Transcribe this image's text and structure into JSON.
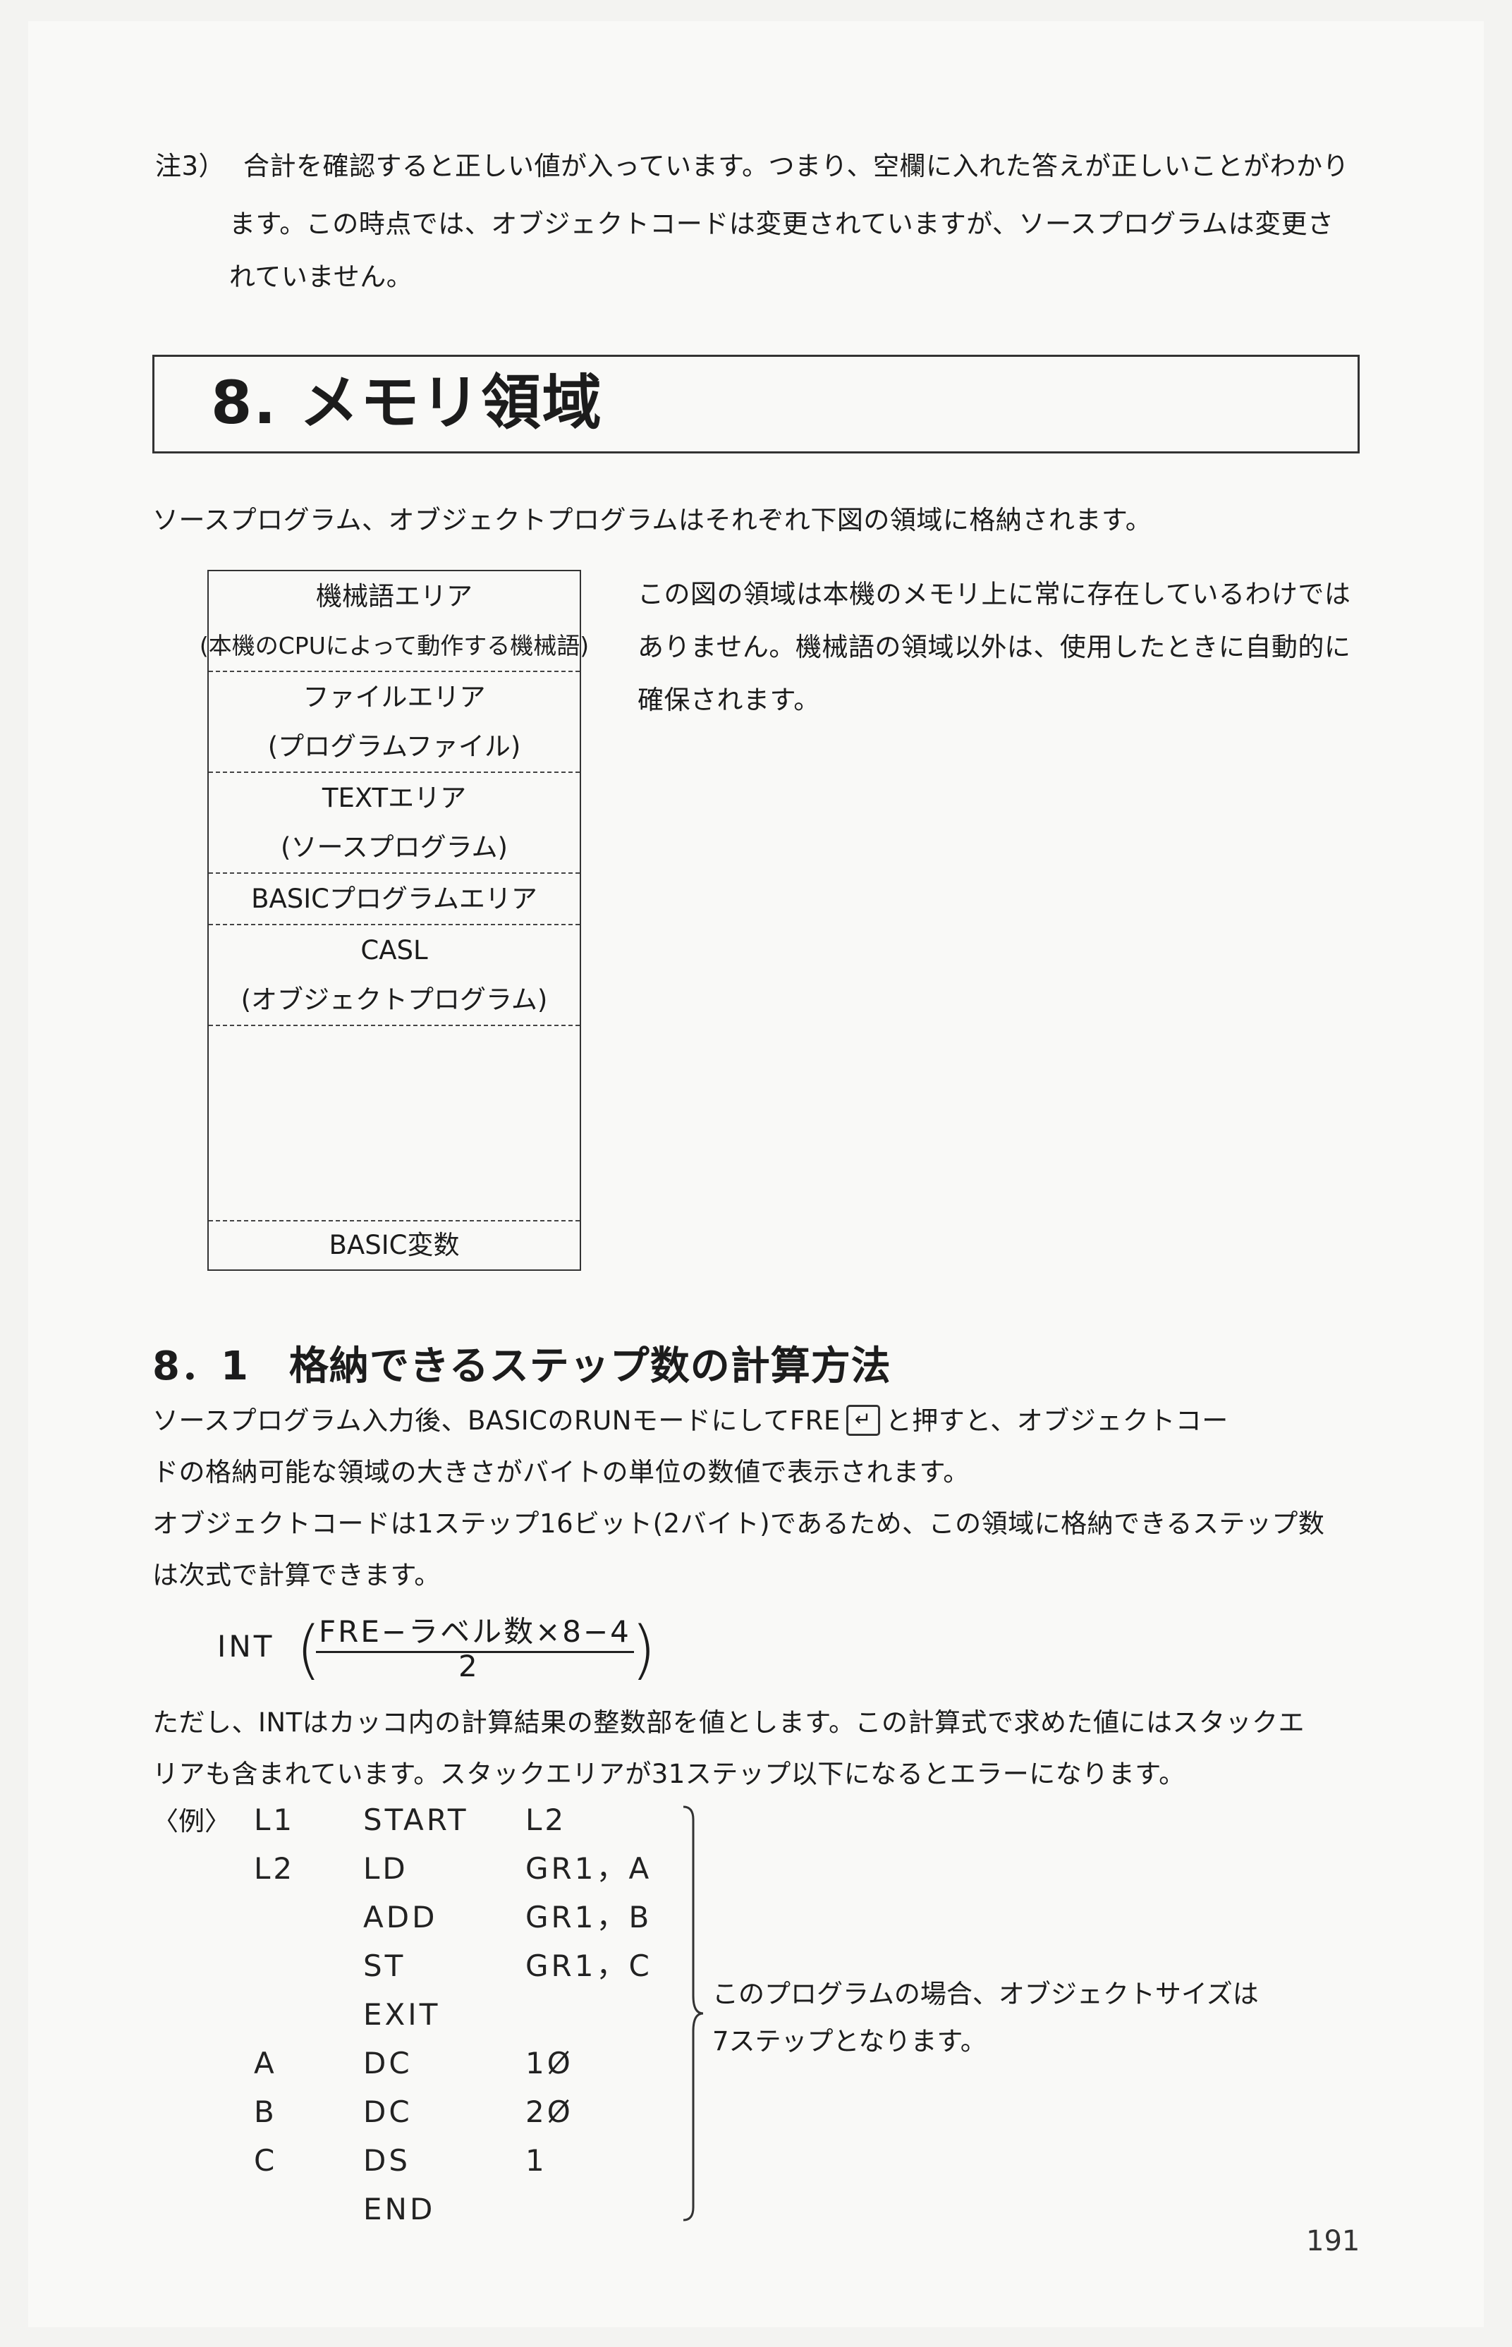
{
  "note": {
    "head": "注3）",
    "line1": "合計を確認すると正しい値が入っています。つまり、空欄に入れた答えが正しいことがわかり",
    "line2": "ます。この時点では、オブジェクトコードは変更されていますが、ソースプログラムは変更さ",
    "line3": "れていません。"
  },
  "section": {
    "title": "8. メモリ領域"
  },
  "intro": "ソースプログラム、オブジェクトプログラムはそれぞれ下図の領域に格納されます。",
  "memory_map": {
    "segments": [
      {
        "line1": "機械語エリア",
        "line2": "(本機のCPUによって動作する機械語)"
      },
      {
        "line1": "ファイルエリア",
        "line2": "(プログラムファイル)"
      },
      {
        "line1": "TEXTエリア",
        "line2": "(ソースプログラム)"
      },
      {
        "line1": "BASICプログラムエリア"
      },
      {
        "line1": "CASL",
        "line2": "(オブジェクトプログラム)"
      },
      {
        "line1": "BASIC変数"
      }
    ]
  },
  "memory_description": {
    "line1": "この図の領域は本機のメモリ上に常に存在しているわけでは",
    "line2": "ありません。機械語の領域以外は、使用したときに自動的に",
    "line3": "確保されます。"
  },
  "subsection": {
    "title": "8．1　格納できるステップ数の計算方法",
    "p1_line1_before": "ソースプログラム入力後、BASICのRUNモードにしてFRE",
    "enter_key": "↵",
    "p1_line1_after": "と押すと、オブジェクトコー",
    "p1_line2": "ドの格納可能な領域の大きさがバイトの単位の数値で表示されます。",
    "p2_line1": "オブジェクトコードは1ステップ16ビット(2バイト)であるため、この領域に格納できるステップ数",
    "p2_line2": "は次式で計算できます。",
    "p3_line1": "ただし、INTはカッコ内の計算結果の整数部を値とします。この計算式で求めた値にはスタックエ",
    "p3_line2": "リアも含まれています。スタックエリアが31ステップ以下になるとエラーになります。"
  },
  "formula": {
    "func": "INT",
    "paren_left": "(",
    "numerator": "FRE−ラベル数×8−4",
    "denominator": "2",
    "paren_right": ")"
  },
  "example": {
    "label": "〈例〉",
    "code": [
      {
        "label": "L1",
        "op": "START",
        "arg": "L2"
      },
      {
        "label": "L2",
        "op": "LD",
        "arg": "GR1，A"
      },
      {
        "label": "",
        "op": "ADD",
        "arg": "GR1，B"
      },
      {
        "label": "",
        "op": "ST",
        "arg": "GR1，C"
      },
      {
        "label": "",
        "op": "EXIT",
        "arg": ""
      },
      {
        "label": "A",
        "op": "DC",
        "arg": "1Ø"
      },
      {
        "label": "B",
        "op": "DC",
        "arg": "2Ø"
      },
      {
        "label": "C",
        "op": "DS",
        "arg": "1"
      },
      {
        "label": "",
        "op": "END",
        "arg": ""
      }
    ],
    "note_line1": "このプログラムの場合、オブジェクトサイズは",
    "note_line2": "7ステップとなります。"
  },
  "page_number": "191"
}
